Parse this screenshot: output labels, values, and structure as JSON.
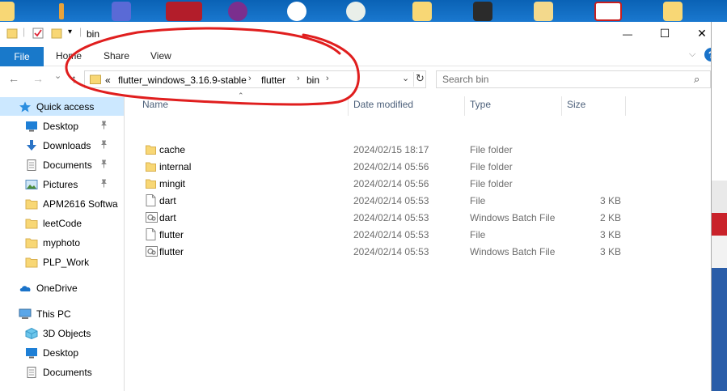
{
  "window": {
    "title": "bin",
    "controls": {
      "minimize": "—",
      "maximize": "☐",
      "close": "✕"
    }
  },
  "ribbon": {
    "file": "File",
    "tabs": [
      "Home",
      "Share",
      "View"
    ],
    "collapse_glyph": "⌵",
    "help": "?"
  },
  "nav": {
    "back": "←",
    "forward": "→",
    "recent": "⌄",
    "up": "↑",
    "overflow": "«",
    "breadcrumb": [
      "flutter_windows_3.16.9-stable",
      "flutter",
      "bin"
    ],
    "separator": "›",
    "dropdown": "⌄",
    "refresh": "↻",
    "search_placeholder": "Search bin",
    "search_glyph": "⌕"
  },
  "sidebar": {
    "items": [
      {
        "label": "Quick access",
        "icon": "star-icon",
        "pinned": false,
        "selected": true,
        "level": 0
      },
      {
        "label": "Desktop",
        "icon": "desktop-icon",
        "pinned": true,
        "selected": false,
        "level": 1
      },
      {
        "label": "Downloads",
        "icon": "download-icon",
        "pinned": true,
        "selected": false,
        "level": 1
      },
      {
        "label": "Documents",
        "icon": "document-icon",
        "pinned": true,
        "selected": false,
        "level": 1
      },
      {
        "label": "Pictures",
        "icon": "pictures-icon",
        "pinned": true,
        "selected": false,
        "level": 1
      },
      {
        "label": "APM2616 Softwa",
        "icon": "folder-icon",
        "pinned": false,
        "selected": false,
        "level": 1
      },
      {
        "label": "leetCode",
        "icon": "folder-icon",
        "pinned": false,
        "selected": false,
        "level": 1
      },
      {
        "label": "myphoto",
        "icon": "folder-icon",
        "pinned": false,
        "selected": false,
        "level": 1
      },
      {
        "label": "PLP_Work",
        "icon": "folder-icon",
        "pinned": false,
        "selected": false,
        "level": 1
      },
      {
        "label": "OneDrive",
        "icon": "cloud-icon",
        "pinned": false,
        "selected": false,
        "level": 0
      },
      {
        "label": "This PC",
        "icon": "computer-icon",
        "pinned": false,
        "selected": false,
        "level": 0
      },
      {
        "label": "3D Objects",
        "icon": "cube-icon",
        "pinned": false,
        "selected": false,
        "level": 1
      },
      {
        "label": "Desktop",
        "icon": "desktop-icon",
        "pinned": false,
        "selected": false,
        "level": 1
      },
      {
        "label": "Documents",
        "icon": "document-icon",
        "pinned": false,
        "selected": false,
        "level": 1
      }
    ],
    "pin_glyph": "📌"
  },
  "filelist": {
    "sort_glyph": "⌃",
    "columns": [
      "Name",
      "Date modified",
      "Type",
      "Size"
    ],
    "rows": [
      {
        "name": "cache",
        "date": "2024/02/15 18:17",
        "type": "File folder",
        "size": "",
        "icon": "folder-icon"
      },
      {
        "name": "internal",
        "date": "2024/02/14 05:56",
        "type": "File folder",
        "size": "",
        "icon": "folder-icon"
      },
      {
        "name": "mingit",
        "date": "2024/02/14 05:56",
        "type": "File folder",
        "size": "",
        "icon": "folder-icon"
      },
      {
        "name": "dart",
        "date": "2024/02/14 05:53",
        "type": "File",
        "size": "3 KB",
        "icon": "file-icon"
      },
      {
        "name": "dart",
        "date": "2024/02/14 05:53",
        "type": "Windows Batch File",
        "size": "2 KB",
        "icon": "batch-file-icon"
      },
      {
        "name": "flutter",
        "date": "2024/02/14 05:53",
        "type": "File",
        "size": "3 KB",
        "icon": "file-icon"
      },
      {
        "name": "flutter",
        "date": "2024/02/14 05:53",
        "type": "Windows Batch File",
        "size": "3 KB",
        "icon": "batch-file-icon"
      }
    ]
  },
  "colors": {
    "accent": "#1979ca",
    "selection": "#cce8ff",
    "folder": "#f8d775",
    "annotation": "#e01e1e",
    "header_text": "#4c607a"
  }
}
